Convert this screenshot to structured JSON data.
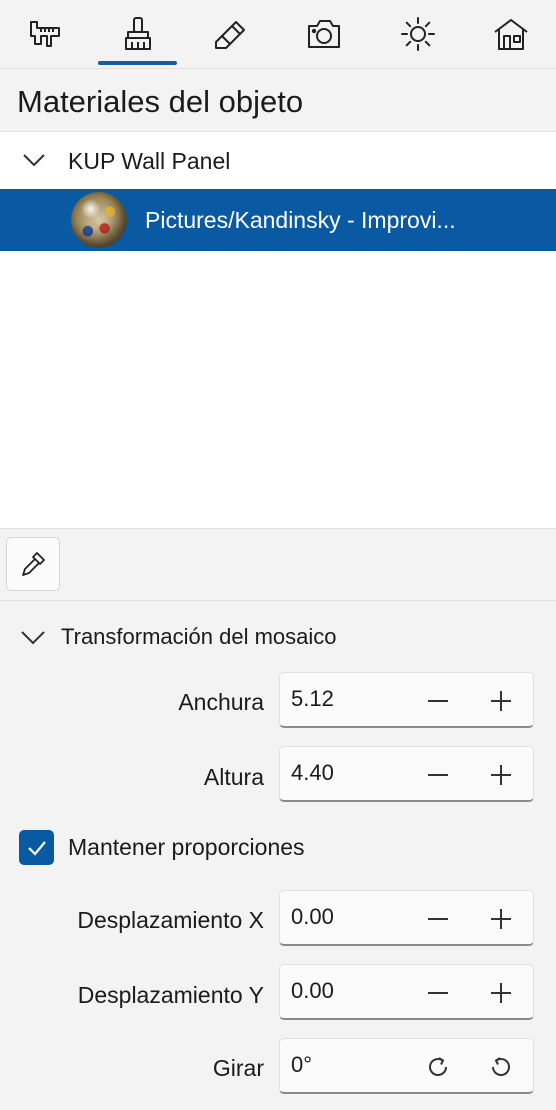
{
  "toolbar": {
    "tabs": [
      {
        "icon": "caliper-icon"
      },
      {
        "icon": "paint-brush-icon",
        "selected": true
      },
      {
        "icon": "pencil-icon"
      },
      {
        "icon": "camera-icon"
      },
      {
        "icon": "sun-icon"
      },
      {
        "icon": "house-icon"
      }
    ],
    "accent": "#0f5ea8"
  },
  "panel_title": "Materiales del objeto",
  "tree": {
    "group_label": "KUP Wall Panel",
    "selected_item_label": "Pictures/Kandinsky - Improvi..."
  },
  "eyedropper": {
    "icon": "eyedropper-icon"
  },
  "tile_transform": {
    "header": "Transformación del mosaico",
    "width": {
      "label": "Anchura",
      "value": "5.12"
    },
    "height": {
      "label": "Altura",
      "value": "4.40"
    },
    "keep_proportions": {
      "label": "Mantener proporciones",
      "checked": true
    },
    "offset_x": {
      "label": "Desplazamiento X",
      "value": "0.00"
    },
    "offset_y": {
      "label": "Desplazamiento Y",
      "value": "0.00"
    },
    "rotate": {
      "label": "Girar",
      "value": "0°"
    }
  },
  "colors": {
    "selection": "#0a5aa3",
    "background": "#f3f3f3"
  }
}
